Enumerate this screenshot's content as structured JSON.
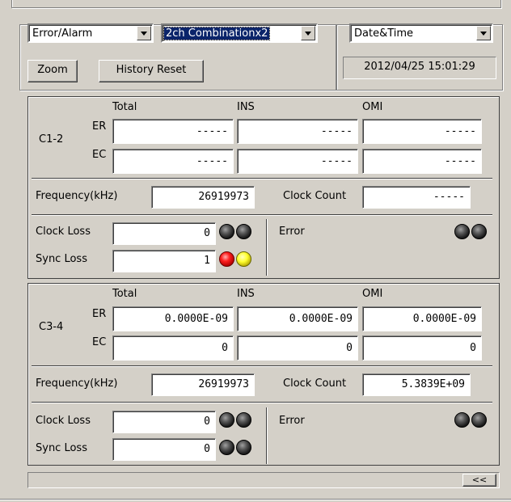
{
  "toolbar": {
    "mode_select": "Error/Alarm",
    "combination_select": "2ch Combinationx2",
    "datetime_select": "Date&Time",
    "datetime_value": "2012/04/25 15:01:29",
    "zoom_label": "Zoom",
    "history_reset_label": "History Reset"
  },
  "columns": {
    "total": "Total",
    "ins": "INS",
    "omi": "OMI"
  },
  "rows": {
    "er": "ER",
    "ec": "EC"
  },
  "labels": {
    "frequency": "Frequency(kHz)",
    "clock_count": "Clock Count",
    "clock_loss": "Clock Loss",
    "sync_loss": "Sync Loss",
    "error": "Error"
  },
  "panels": [
    {
      "name": "C1-2",
      "er": {
        "total": "-----",
        "ins": "-----",
        "omi": "-----"
      },
      "ec": {
        "total": "-----",
        "ins": "-----",
        "omi": "-----"
      },
      "frequency": "26919973",
      "clock_count": "-----",
      "clock_loss": "0",
      "sync_loss": "1",
      "leds": {
        "clock_loss": [
          "black",
          "black"
        ],
        "sync_loss": [
          "red",
          "yellow"
        ],
        "error": [
          "black",
          "black"
        ]
      }
    },
    {
      "name": "C3-4",
      "er": {
        "total": "0.0000E-09",
        "ins": "0.0000E-09",
        "omi": "0.0000E-09"
      },
      "ec": {
        "total": "0",
        "ins": "0",
        "omi": "0"
      },
      "frequency": "26919973",
      "clock_count": "5.3839E+09",
      "clock_loss": "0",
      "sync_loss": "0",
      "leds": {
        "clock_loss": [
          "black",
          "black"
        ],
        "sync_loss": [
          "black",
          "black"
        ],
        "error": [
          "black",
          "black"
        ]
      }
    }
  ],
  "footer": {
    "collapse_label": "<<"
  }
}
